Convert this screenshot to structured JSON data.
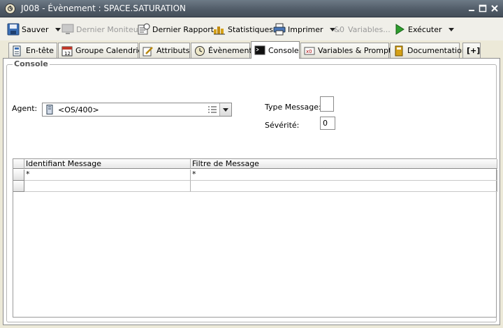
{
  "window": {
    "title": "J008 - Évènement : SPACE.SATURATION"
  },
  "toolbar": {
    "save": "Sauver",
    "last_monitor": "Dernier Moniteur",
    "last_report": "Dernier Rapport",
    "statistics": "Statistiques",
    "print": "Imprimer",
    "variables": "Variables...",
    "execute": "Exécuter"
  },
  "tabs": [
    {
      "label": "En-tête"
    },
    {
      "label": "Groupe Calendrier"
    },
    {
      "label": "Attributs"
    },
    {
      "label": "Évènement"
    },
    {
      "label": "Console"
    },
    {
      "label": "Variables & Prompts"
    },
    {
      "label": "Documentation"
    },
    {
      "label": "[+]"
    }
  ],
  "active_tab": "Console",
  "console": {
    "section_title": "Console",
    "agent_label": "Agent:",
    "agent_value": "<OS/400>",
    "type_message_label": "Type Message:",
    "type_message_value": "",
    "severity_label": "Sévérité:",
    "severity_value": "0",
    "grid": {
      "columns": [
        "Identifiant Message",
        "Filtre de Message"
      ],
      "rows": [
        [
          "*",
          "*"
        ],
        [
          "",
          ""
        ]
      ]
    }
  },
  "colors": {
    "titlebar": "#4f5a66",
    "accent_green": "#2e9e2e",
    "background": "#ece9d8"
  }
}
